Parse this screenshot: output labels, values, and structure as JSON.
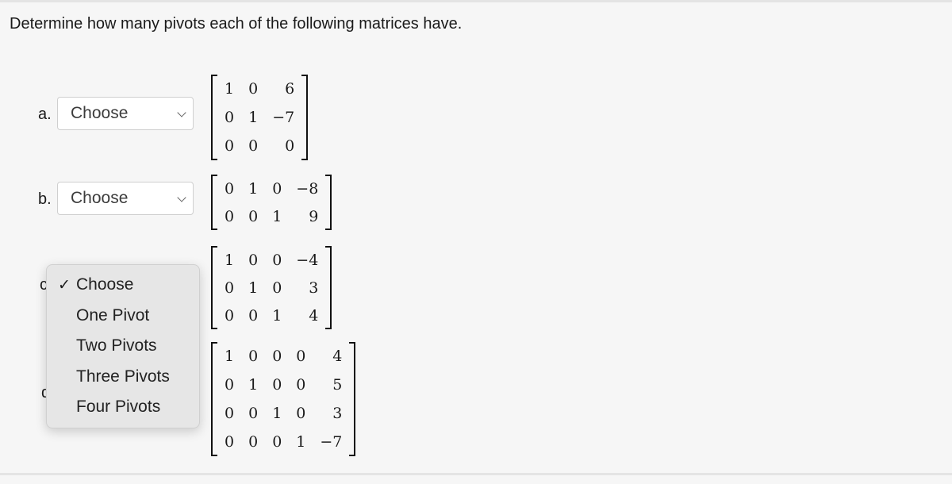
{
  "question": "Determine how many pivots each of the following matrices have.",
  "items": [
    {
      "label": "a.",
      "select": "Choose",
      "matrix": [
        [
          "1",
          "0",
          "6"
        ],
        [
          "0",
          "1",
          "−7"
        ],
        [
          "0",
          "0",
          "0"
        ]
      ]
    },
    {
      "label": "b.",
      "select": "Choose",
      "matrix": [
        [
          "0",
          "1",
          "0",
          "−8"
        ],
        [
          "0",
          "0",
          "1",
          "9"
        ]
      ]
    },
    {
      "label": "c",
      "select": "Choose",
      "matrix": [
        [
          "1",
          "0",
          "0",
          "−4"
        ],
        [
          "0",
          "1",
          "0",
          "3"
        ],
        [
          "0",
          "0",
          "1",
          "4"
        ]
      ]
    },
    {
      "label": "d",
      "select": "Choose",
      "matrix": [
        [
          "1",
          "0",
          "0",
          "0",
          "4"
        ],
        [
          "0",
          "1",
          "0",
          "0",
          "5"
        ],
        [
          "0",
          "0",
          "1",
          "0",
          "3"
        ],
        [
          "0",
          "0",
          "0",
          "1",
          "−7"
        ]
      ]
    }
  ],
  "dropdown": {
    "check": "✓",
    "options": [
      "Choose",
      "One Pivot",
      "Two Pivots",
      "Three Pivots",
      "Four Pivots"
    ],
    "selected": "Choose"
  }
}
